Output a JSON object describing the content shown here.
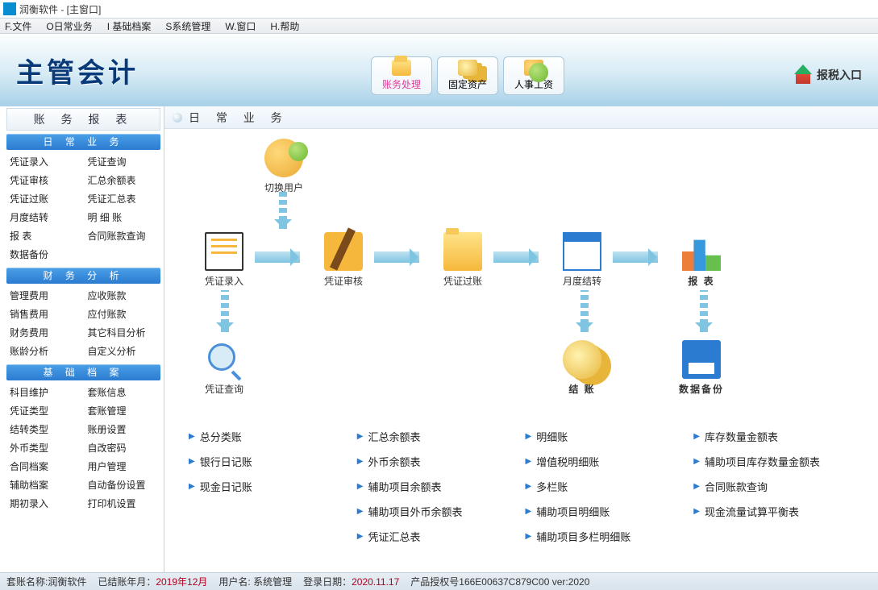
{
  "window": {
    "title": "润衡软件 - [主窗口]"
  },
  "menu": [
    "F.文件",
    "O日常业务",
    "I 基础档案",
    "S系统管理",
    "W.窗口",
    "H.帮助"
  ],
  "banner": {
    "logo": "主管会计",
    "buttons": [
      {
        "id": "accounting",
        "label": "账务处理",
        "selected": true
      },
      {
        "id": "assets",
        "label": "固定资产",
        "selected": false
      },
      {
        "id": "payroll",
        "label": "人事工资",
        "selected": false
      }
    ],
    "tax_entry": "报税入口"
  },
  "sidebar": {
    "title": "账 务 报 表",
    "groups": [
      {
        "header": "日 常 业 务",
        "items": [
          "凭证录入",
          "凭证查询",
          "凭证审核",
          "汇总余额表",
          "凭证过账",
          "凭证汇总表",
          "月度结转",
          "明 细 账",
          "报   表",
          "合同账款查询",
          "数据备份",
          ""
        ]
      },
      {
        "header": "财 务 分 析",
        "items": [
          "管理费用",
          "应收账款",
          "销售费用",
          "应付账款",
          "财务费用",
          "其它科目分析",
          "账龄分析",
          "自定义分析"
        ]
      },
      {
        "header": "基 础 档 案",
        "items": [
          "科目维护",
          "套账信息",
          "凭证类型",
          "套账管理",
          "结转类型",
          "账册设置",
          "外币类型",
          "自改密码",
          "合同档案",
          "用户管理",
          "辅助档案",
          "自动备份设置",
          "期初录入",
          "打印机设置"
        ]
      }
    ]
  },
  "main": {
    "title": "日 常 业 务",
    "nodes": {
      "switch_user": "切换用户",
      "entry": "凭证录入",
      "audit": "凭证审核",
      "post": "凭证过账",
      "month_end": "月度结转",
      "report": "报  表",
      "query": "凭证查询",
      "close": "结  账",
      "backup": "数据备份"
    },
    "reports": [
      [
        "总分类账",
        "汇总余额表",
        "明细账",
        "库存数量金额表"
      ],
      [
        "银行日记账",
        "外币余额表",
        "增值税明细账",
        "辅助项目库存数量金额表"
      ],
      [
        "现金日记账",
        "辅助项目余额表",
        "多栏账",
        "合同账款查询"
      ],
      [
        "",
        "辅助项目外币余额表",
        "辅助项目明细账",
        "现金流量试算平衡表"
      ],
      [
        "",
        "凭证汇总表",
        "辅助项目多栏明细账",
        ""
      ]
    ]
  },
  "status": {
    "account": "套账名称:润衡软件",
    "closed": "已结账年月：",
    "closed_val": "2019年12月",
    "user": "用户名: 系统管理",
    "login": "登录日期：",
    "login_val": "2020.11.17",
    "lic": "产品授权号166E00637C879C00 ver:2020"
  }
}
